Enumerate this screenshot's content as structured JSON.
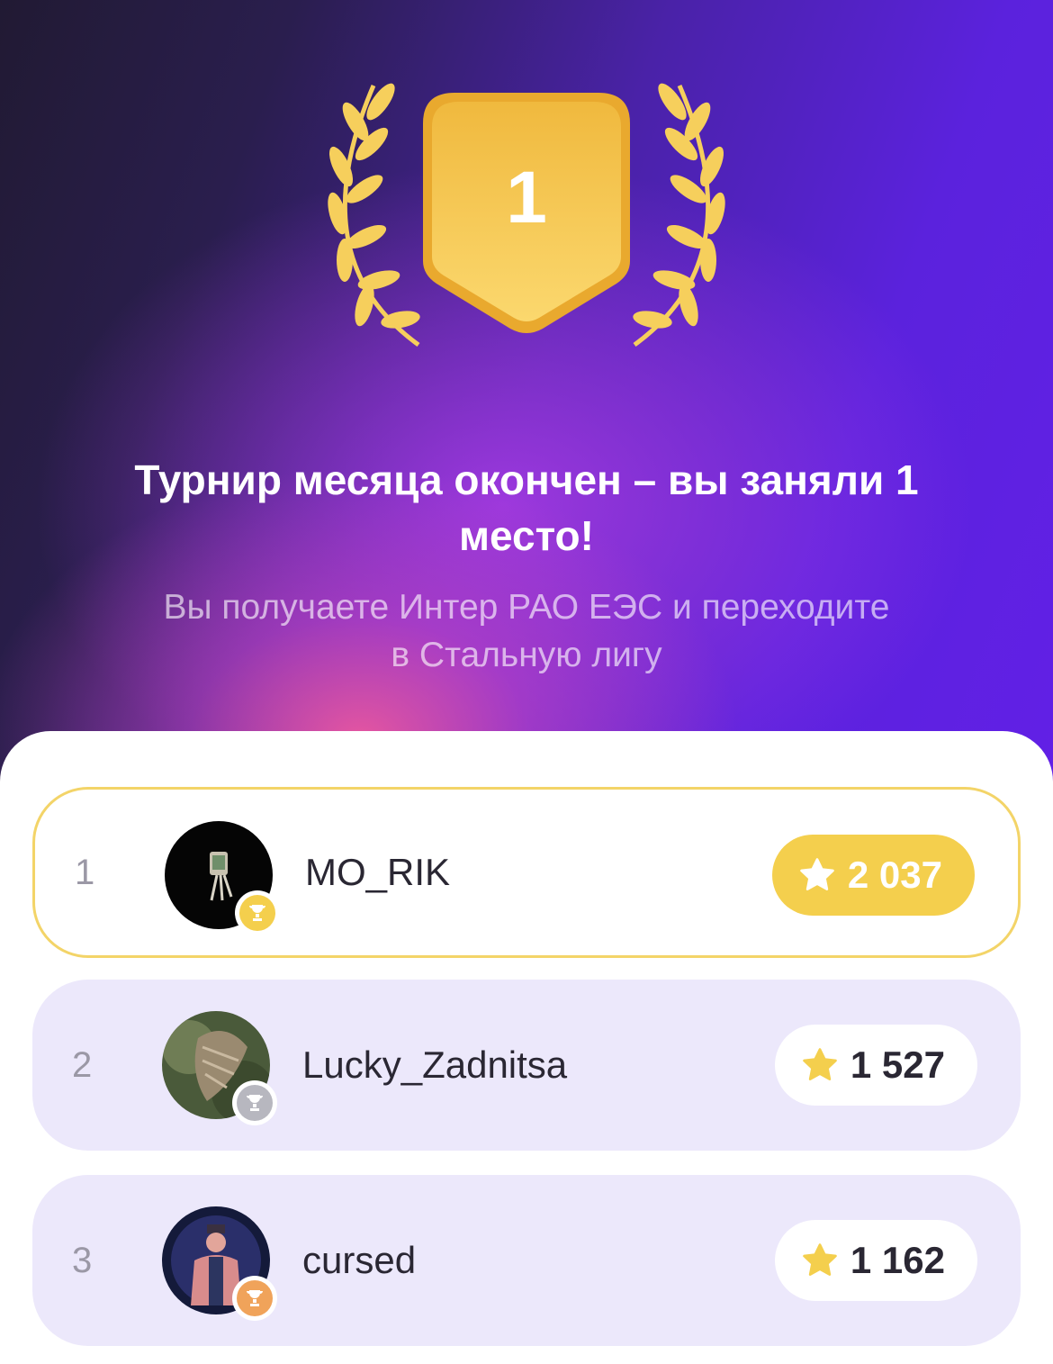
{
  "hero": {
    "badge_number": "1",
    "title": "Турнир месяца окончен – вы заняли 1 место!",
    "subtitle": "Вы получаете Интер РАО ЕЭС и переходите в Стальную лигу"
  },
  "leaderboard": [
    {
      "rank": "1",
      "name": "MO_RIK",
      "score": "2 037",
      "trophy": "gold-trophy-icon"
    },
    {
      "rank": "2",
      "name": "Lucky_Zadnitsa",
      "score": "1 527",
      "trophy": "silver-trophy-icon"
    },
    {
      "rank": "3",
      "name": "cursed",
      "score": "1 162",
      "trophy": "bronze-trophy-icon"
    }
  ],
  "colors": {
    "gold": "#f4cf4d",
    "row_background": "#ece8fb",
    "highlight_border": "#f3d468",
    "hero_purple": "#6220e6",
    "silver": "#b7b7bf",
    "bronze": "#f0a35a"
  },
  "icons": [
    "laurel-left-icon",
    "laurel-right-icon",
    "shield-badge-icon",
    "star-icon",
    "trophy-icon"
  ]
}
